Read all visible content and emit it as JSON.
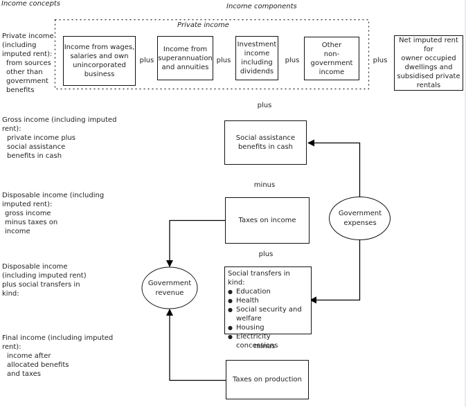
{
  "headings": {
    "income_concepts": "Income concepts",
    "income_components": "Income components",
    "private_income_group": "Private income"
  },
  "concepts": [
    {
      "title": "Private income\n(including\nimputed rent):",
      "detail": "from sources\nother than\ngovernment\nbenefits"
    },
    {
      "title": "Gross income (including imputed\nrent):",
      "detail": "private income plus\nsocial assistance\nbenefits in cash"
    },
    {
      "title": "Disposable income (including\nimputed rent):",
      "detail": "gross income\nminus taxes on\nincome"
    },
    {
      "title": "Disposable income\n(including imputed rent)\nplus social transfers in\nkind:",
      "detail": ""
    },
    {
      "title": "Final income (including imputed\nrent):",
      "detail": "income after\nallocated benefits\nand taxes"
    }
  ],
  "components": {
    "wages": "Income from wages,\nsalaries and own\nunincorporated\nbusiness",
    "superannuation": "Income from\nsuperannuation\nand annuities",
    "investment": "Investment\nincome\nincluding\ndividends",
    "other": "Other\nnon-government\nincome",
    "imputed_rent": "Net imputed rent for\nowner occupied\ndwellings and\nsubsidised private\nrentals"
  },
  "operators": {
    "plus_1": "plus",
    "plus_2": "plus",
    "plus_3": "plus",
    "plus_4": "plus",
    "plus_gross": "plus",
    "minus_tax": "minus",
    "plus_transfers": "plus",
    "minus_production": "minus"
  },
  "flow": {
    "social_assistance": "Social assistance\nbenefits in cash",
    "taxes_income": "Taxes on income",
    "social_transfers_title": "Social transfers in kind:",
    "social_transfers_items": [
      "Education",
      "Health",
      "Social security and\nwelfare",
      "Housing",
      "Electricity concessions"
    ],
    "taxes_production": "Taxes on production",
    "gov_expenses": "Government\nexpenses",
    "gov_revenue": "Government\nrevenue"
  }
}
